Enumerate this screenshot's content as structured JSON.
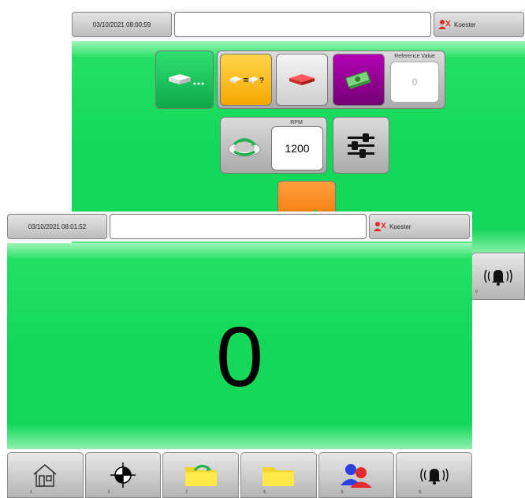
{
  "back_screen": {
    "datetime": "03/10/2021 08:00:59",
    "user": "Koester",
    "reference_label": "Reference Value",
    "reference_value": "0",
    "rpm_label": "RPM",
    "rpm_value": "1200",
    "alarm_number": "9"
  },
  "front_screen": {
    "datetime": "03/10/2021 08:01:52",
    "user": "Koester",
    "count": "0",
    "nav": [
      {
        "icon": "home-icon",
        "num": "1"
      },
      {
        "icon": "crosshair-icon",
        "num": "2"
      },
      {
        "icon": "folder-refresh-icon",
        "num": "7"
      },
      {
        "icon": "folder-icon",
        "num": "8"
      },
      {
        "icon": "users-icon",
        "num": "6"
      },
      {
        "icon": "alarm-bell-icon",
        "num": "9"
      }
    ]
  },
  "colors": {
    "green": "#13d85a",
    "yellow": "#ffc321",
    "purple": "#8a008a",
    "orange": "#ff8a1e",
    "folder_yellow": "#ffe94a"
  }
}
